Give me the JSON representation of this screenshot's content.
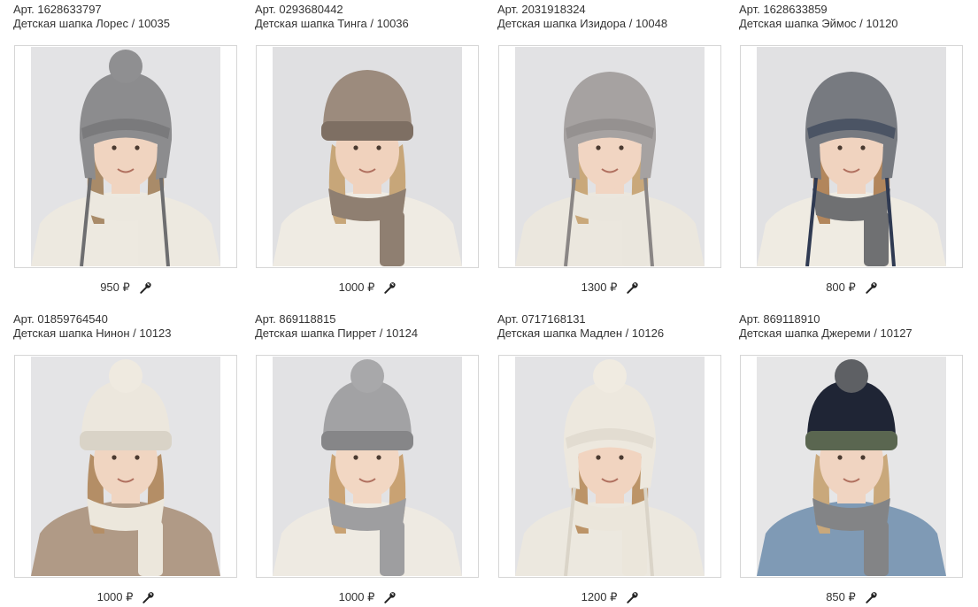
{
  "products": [
    {
      "article": "Арт. 1628633797",
      "name": "Детская шапка Лорес / 10035",
      "price": "950 ₽",
      "bg": "#e3e3e5",
      "hat": "#8c8c8e",
      "hat_dark": "#6e6e70",
      "pompom": "#8f8f91",
      "scarf": "#ece8df",
      "sweater": "#ede9e0",
      "hair": "#a98b69",
      "skin": "#f0d4c0",
      "icon": "wrench-icon",
      "hat_style": "earflap",
      "pompom_on": true
    },
    {
      "article": "Арт. 0293680442",
      "name": "Детская шапка Тинга / 10036",
      "price": "1000 ₽",
      "bg": "#e0e0e2",
      "hat": "#9c8b7d",
      "hat_dark": "#7e6f63",
      "pompom": "#9c8b7d",
      "scarf": "#8f7f71",
      "sweater": "#efebe3",
      "hair": "#c7a679",
      "skin": "#f0d2bd",
      "icon": "wrench-icon",
      "hat_style": "beanie",
      "pompom_on": false
    },
    {
      "article": "Арт. 2031918324",
      "name": "Детская шапка Изидора / 10048",
      "price": "1300 ₽",
      "bg": "#e2e2e4",
      "hat": "#a6a2a1",
      "hat_dark": "#8a8685",
      "pompom": "#b9b5b3",
      "scarf": "#eae6dd",
      "sweater": "#ebe7de",
      "hair": "#c9a87a",
      "skin": "#f1d5c2",
      "icon": "wrench-icon",
      "hat_style": "earflap",
      "pompom_on": false
    },
    {
      "article": "Арт. 1628633859",
      "name": "Детская шапка Эймос / 10120",
      "price": "800 ₽",
      "bg": "#e1e1e3",
      "hat": "#777a80",
      "hat_dark": "#2f3a52",
      "pompom": "#777a80",
      "scarf": "#6f7072",
      "sweater": "#efebe2",
      "hair": "#b2865c",
      "skin": "#f0d3bf",
      "icon": "wrench-icon",
      "hat_style": "earflap",
      "pompom_on": false
    },
    {
      "article": "Арт. 01859764540",
      "name": "Детская шапка Нинон / 10123",
      "price": "1000 ₽",
      "bg": "#e4e4e6",
      "hat": "#ece7dd",
      "hat_dark": "#d9d3c7",
      "pompom": "#efeae0",
      "scarf": "#ece7dc",
      "sweater": "#b09a86",
      "hair": "#b48e66",
      "skin": "#f0d5c1",
      "icon": "wrench-icon",
      "hat_style": "beanie",
      "pompom_on": true
    },
    {
      "article": "Арт. 869118815",
      "name": "Детская шапка Пиррет / 10124",
      "price": "1000 ₽",
      "bg": "#e2e2e4",
      "hat": "#a2a2a4",
      "hat_dark": "#868688",
      "pompom": "#a8a8aa",
      "scarf": "#9e9ea0",
      "sweater": "#eeeae2",
      "hair": "#c9a273",
      "skin": "#f2d7c3",
      "icon": "wrench-icon",
      "hat_style": "beanie",
      "pompom_on": true
    },
    {
      "article": "Арт. 0717168131",
      "name": "Детская шапка Мадлен / 10126",
      "price": "1200 ₽",
      "bg": "#e3e3e5",
      "hat": "#ede8de",
      "hat_dark": "#dad4c8",
      "pompom": "#f0ebe1",
      "scarf": "#ebe6db",
      "sweater": "#ece8df",
      "hair": "#bc9468",
      "skin": "#f1d4c0",
      "icon": "wrench-icon",
      "hat_style": "earflap",
      "pompom_on": true
    },
    {
      "article": "Арт. 869118910",
      "name": "Детская шапка Джереми / 10127",
      "price": "850 ₽",
      "bg": "#e6e6e7",
      "hat": "#1f2535",
      "hat_dark": "#5a6650",
      "pompom": "#5e6064",
      "scarf": "#838486",
      "sweater": "#7f9ab5",
      "hair": "#c9a87b",
      "skin": "#f0d4c1",
      "icon": "wrench-icon",
      "hat_style": "beanie",
      "pompom_on": true
    }
  ]
}
